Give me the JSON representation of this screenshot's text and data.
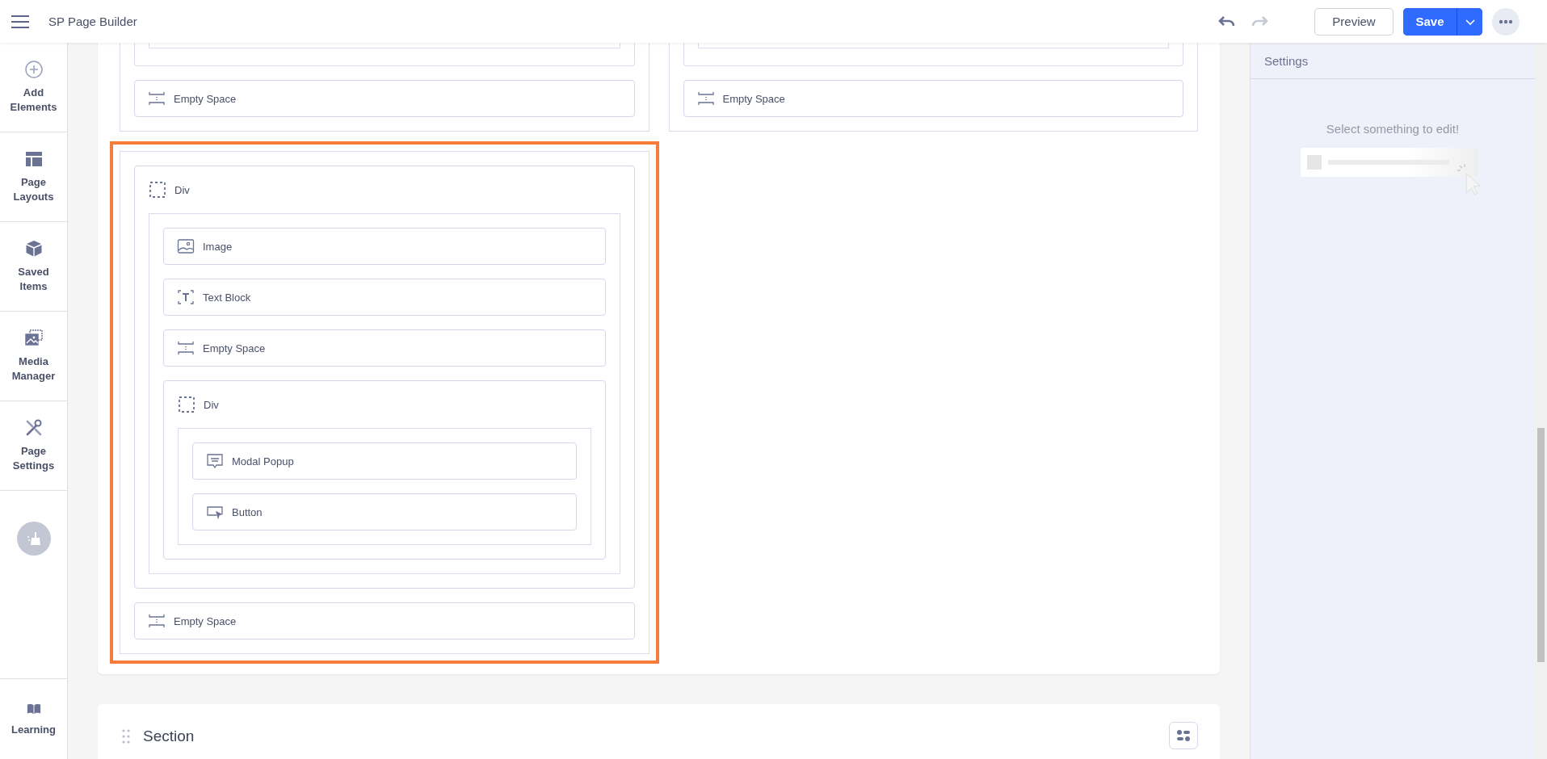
{
  "app": {
    "title": "SP Page Builder"
  },
  "history": [
    {
      "kind": "undo",
      "disabled": false
    },
    {
      "kind": "redo",
      "disabled": true
    }
  ],
  "preview_button": "Preview",
  "save_button": "Save",
  "sidebar": {
    "items": [
      {
        "kind": "add",
        "label": "Add Elements"
      },
      {
        "kind": "layouts",
        "label": "Page Layouts"
      },
      {
        "kind": "saved",
        "label": "Saved Items"
      },
      {
        "kind": "media",
        "label": "Media Manager"
      },
      {
        "kind": "settings",
        "label": "Page Settings"
      }
    ],
    "footer": {
      "label": "Learning"
    }
  },
  "canvas": {
    "columns": [
      {
        "selected": false,
        "items": [
          {
            "kind": "cut_container"
          },
          {
            "kind": "empty_space",
            "label": "Empty Space"
          }
        ]
      },
      {
        "selected": false,
        "items": [
          {
            "kind": "cut_container"
          },
          {
            "kind": "empty_space",
            "label": "Empty Space"
          }
        ]
      },
      {
        "selected": true,
        "items": [
          {
            "kind": "div",
            "label": "Div",
            "children": [
              {
                "kind": "image",
                "label": "Image"
              },
              {
                "kind": "text_block",
                "label": "Text Block"
              },
              {
                "kind": "empty_space",
                "label": "Empty Space"
              },
              {
                "kind": "div",
                "label": "Div",
                "children": [
                  {
                    "kind": "modal_popup",
                    "label": "Modal Popup"
                  },
                  {
                    "kind": "button",
                    "label": "Button"
                  }
                ]
              }
            ]
          },
          {
            "kind": "empty_space",
            "label": "Empty Space"
          }
        ]
      }
    ],
    "section": {
      "title": "Section"
    }
  },
  "settings_panel": {
    "title": "Settings",
    "empty_message": "Select something to edit!"
  }
}
